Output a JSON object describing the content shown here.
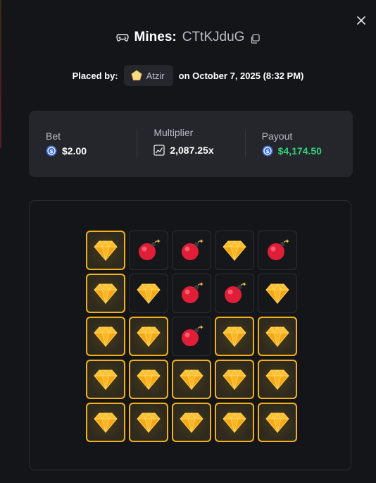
{
  "modal": {
    "close_label": "×",
    "title": {
      "game_name": "Mines:",
      "game_id": "CTtKJduG",
      "icon": "gamepad-icon",
      "copy_icon": "copy-icon"
    },
    "placed": {
      "label": "Placed by:",
      "user": "Atzir",
      "user_icon": "pentagon-icon",
      "date_text": "on October 7, 2025 (8:32 PM)"
    }
  },
  "stats": {
    "bet": {
      "label": "Bet",
      "value": "$2.00",
      "icon": "coin-icon"
    },
    "multiplier": {
      "label": "Multiplier",
      "value": "2,087.25x",
      "icon": "chart-icon"
    },
    "payout": {
      "label": "Payout",
      "value": "$4,174.50",
      "icon": "coin-icon",
      "color": "#33d17a"
    }
  },
  "colors": {
    "accent_gold": "#f3b01c",
    "payout_green": "#33d17a",
    "bomb_red": "#e01e37"
  },
  "board": {
    "rows": [
      [
        {
          "type": "gem",
          "picked": true
        },
        {
          "type": "mine",
          "picked": false
        },
        {
          "type": "mine",
          "picked": false
        },
        {
          "type": "gem",
          "picked": false
        },
        {
          "type": "mine",
          "picked": false
        }
      ],
      [
        {
          "type": "gem",
          "picked": true
        },
        {
          "type": "gem",
          "picked": false
        },
        {
          "type": "mine",
          "picked": false
        },
        {
          "type": "mine",
          "picked": false
        },
        {
          "type": "gem",
          "picked": false
        }
      ],
      [
        {
          "type": "gem",
          "picked": true
        },
        {
          "type": "gem",
          "picked": true
        },
        {
          "type": "mine",
          "picked": false
        },
        {
          "type": "gem",
          "picked": true
        },
        {
          "type": "gem",
          "picked": true
        }
      ],
      [
        {
          "type": "gem",
          "picked": true
        },
        {
          "type": "gem",
          "picked": true
        },
        {
          "type": "gem",
          "picked": true
        },
        {
          "type": "gem",
          "picked": true
        },
        {
          "type": "gem",
          "picked": true
        }
      ],
      [
        {
          "type": "gem",
          "picked": true
        },
        {
          "type": "gem",
          "picked": true
        },
        {
          "type": "gem",
          "picked": true
        },
        {
          "type": "gem",
          "picked": true
        },
        {
          "type": "gem",
          "picked": true
        }
      ]
    ]
  }
}
